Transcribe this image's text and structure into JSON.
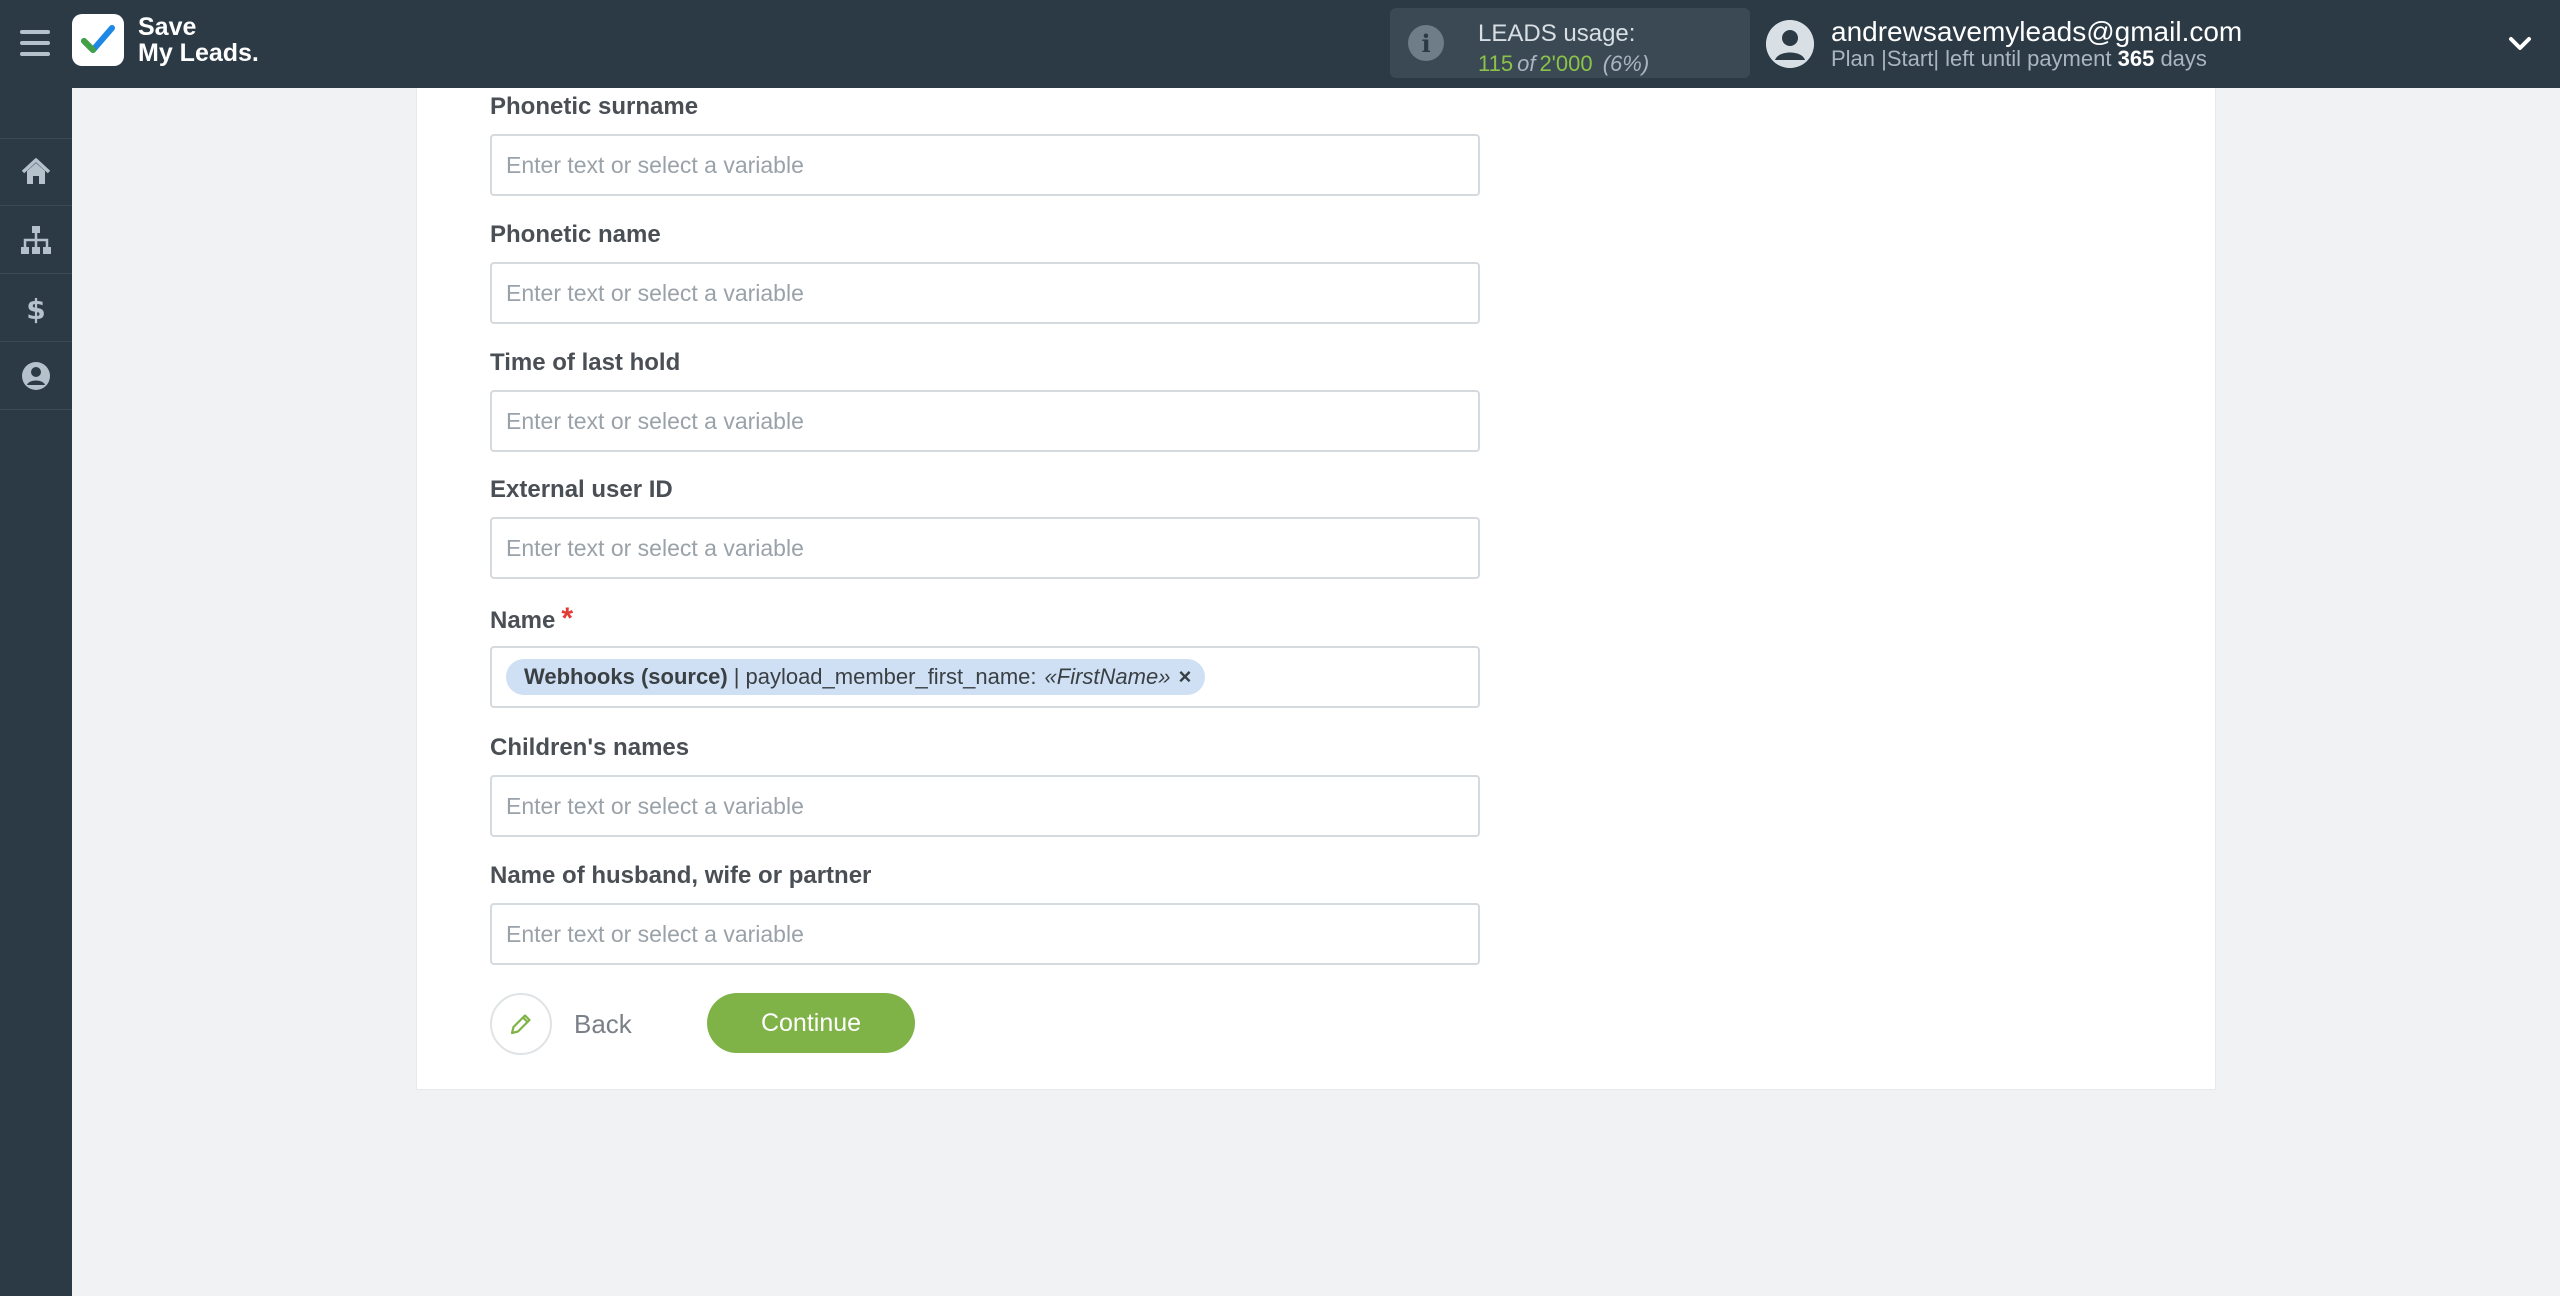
{
  "header": {
    "logo_line1": "Save",
    "logo_line2": "My Leads.",
    "usage_title": "LEADS usage:",
    "usage_used": "115",
    "usage_of": "of",
    "usage_total": "2'000",
    "usage_percent": "(6%)",
    "email": "andrewsavemyleads@gmail.com",
    "plan_text": "Plan |Start| left until payment",
    "plan_days": "365",
    "plan_days_suffix": "days"
  },
  "sidebar": {
    "items": [
      {
        "icon": "home-icon"
      },
      {
        "icon": "sitemap-icon"
      },
      {
        "icon": "dollar-icon"
      },
      {
        "icon": "user-circle-icon"
      }
    ]
  },
  "form": {
    "placeholder": "Enter text or select a variable",
    "fields": [
      {
        "label": "Phonetic surname"
      },
      {
        "label": "Phonetic name"
      },
      {
        "label": "Time of last hold"
      },
      {
        "label": "External user ID"
      },
      {
        "label": "Name",
        "required": "*"
      },
      {
        "label": "Children's names"
      },
      {
        "label": "Name of husband, wife or partner"
      }
    ],
    "name_chip": {
      "source": "Webhooks (source)",
      "separator": "|",
      "field": "payload_member_first_name:",
      "variable": "«FirstName»",
      "remove": "×"
    }
  },
  "actions": {
    "back_label": "Back",
    "continue_label": "Continue"
  },
  "colors": {
    "topbar": "#2b3a45",
    "accent_green": "#7fb347",
    "chip_bg": "#cfe0f4",
    "required": "#e53935"
  }
}
